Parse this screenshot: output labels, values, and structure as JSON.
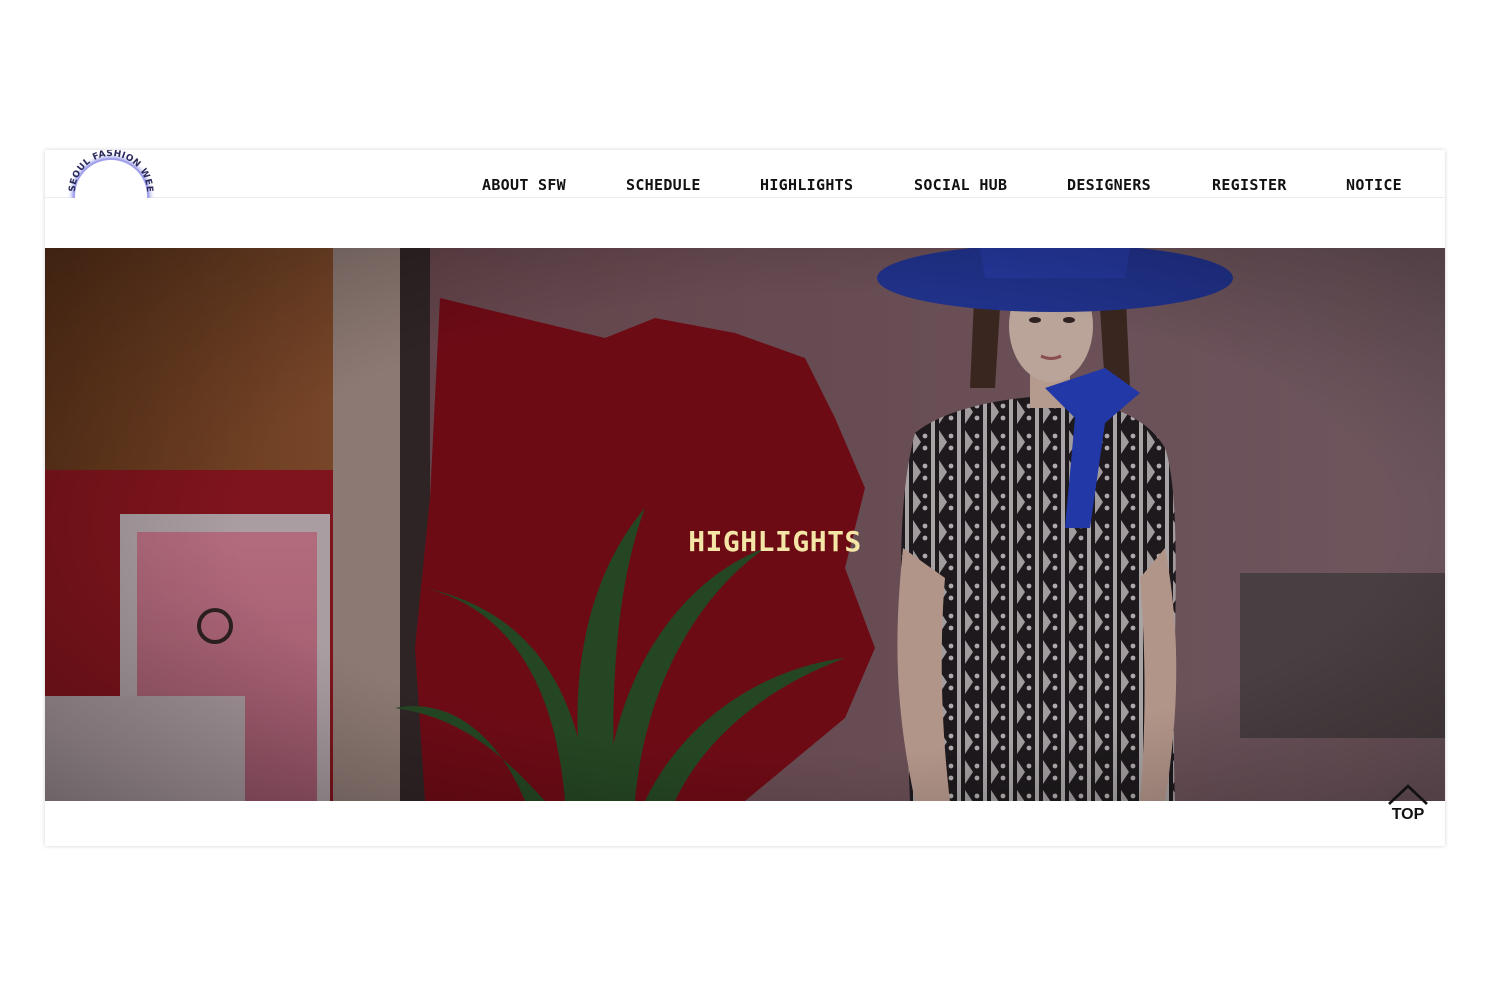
{
  "logo": {
    "text": "SEOUL FASHION WEEK",
    "icon": "sfw-circle-logo",
    "color": "#6b6bd6"
  },
  "nav": {
    "items": [
      {
        "label": "ABOUT SFW"
      },
      {
        "label": "SCHEDULE"
      },
      {
        "label": "HIGHLIGHTS"
      },
      {
        "label": "SOCIAL HUB"
      },
      {
        "label": "DESIGNERS"
      },
      {
        "label": "REGISTER"
      },
      {
        "label": "NOTICE"
      }
    ]
  },
  "hero": {
    "title": "HIGHLIGHTS",
    "title_color": "#f3e6a6",
    "image": "fashion-model-blue-hat-photo"
  },
  "top_button": {
    "label": "TOP",
    "icon": "chevron-up-icon"
  }
}
